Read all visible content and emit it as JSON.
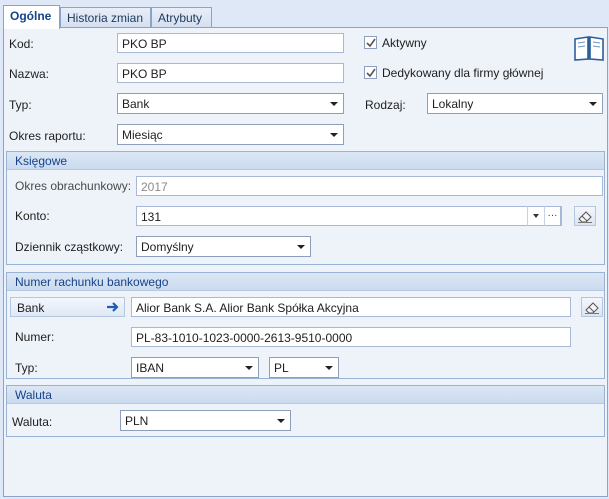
{
  "tabs": [
    {
      "label": "Ogólne",
      "active": true
    },
    {
      "label": "Historia zmian",
      "active": false
    },
    {
      "label": "Atrybuty",
      "active": false
    }
  ],
  "general": {
    "kod_label": "Kod:",
    "kod_value": "PKO BP",
    "nazwa_label": "Nazwa:",
    "nazwa_value": "PKO BP",
    "typ_label": "Typ:",
    "typ_value": "Bank",
    "rodzaj_label": "Rodzaj:",
    "rodzaj_value": "Lokalny",
    "okres_label": "Okres raportu:",
    "okres_value": "Miesiąc",
    "aktywny_label": "Aktywny",
    "aktywny_checked": true,
    "dedykowany_label": "Dedykowany dla firmy głównej",
    "dedykowany_checked": true,
    "book_icon": "book-icon"
  },
  "ksiegowe": {
    "title": "Księgowe",
    "okres_label": "Okres obrachunkowy:",
    "okres_value": "2017",
    "konto_label": "Konto:",
    "konto_value": "131",
    "konto_more": "···",
    "dziennik_label": "Dziennik cząstkowy:",
    "dziennik_value": "Domyślny"
  },
  "rachunek": {
    "title": "Numer rachunku bankowego",
    "bank_button": "Bank",
    "bank_value": "Alior Bank S.A.  Alior Bank Spółka Akcyjna",
    "numer_label": "Numer:",
    "numer_value": "PL-83-1010-1023-0000-2613-9510-0000",
    "typ_label": "Typ:",
    "typ_value": "IBAN",
    "kraj_value": "PL"
  },
  "waluta": {
    "title": "Waluta",
    "label": "Waluta:",
    "value": "PLN"
  },
  "colors": {
    "accent": "#15428b",
    "panel": "#eef3fa",
    "border": "#8ba3c7"
  }
}
